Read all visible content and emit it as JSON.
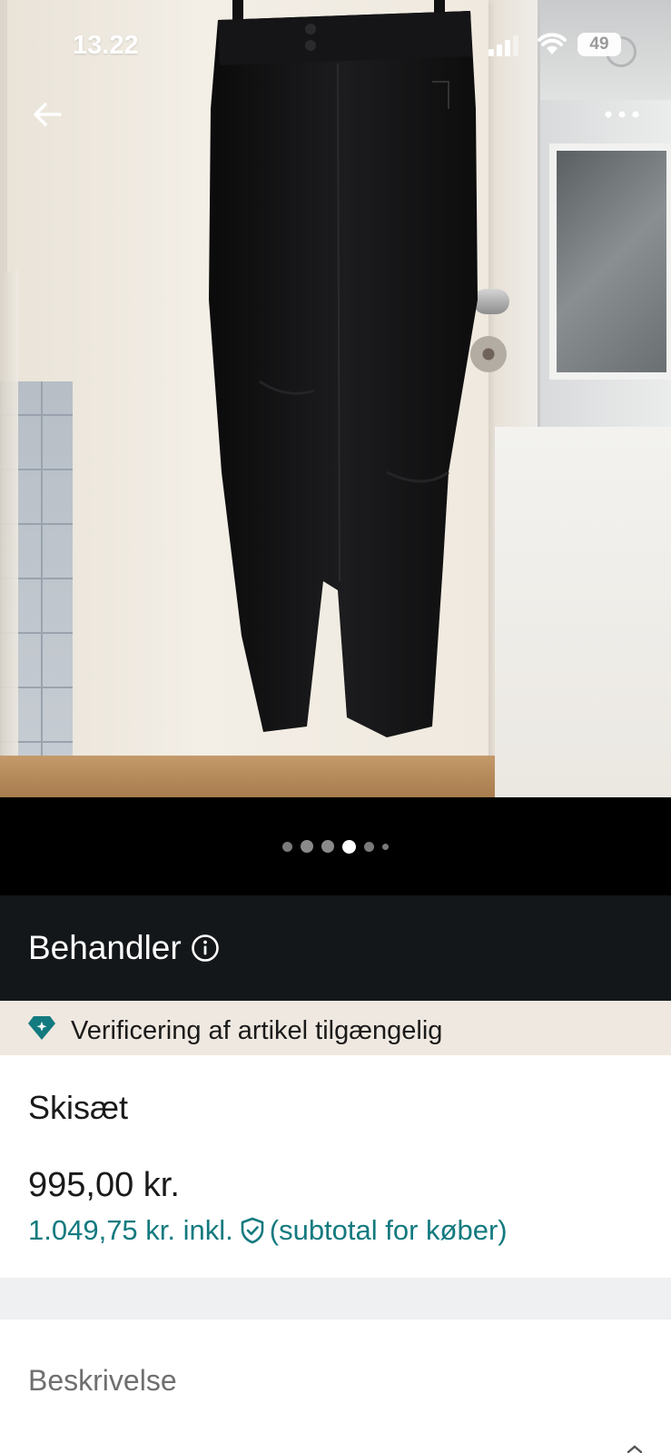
{
  "status_bar": {
    "time": "13.22",
    "battery": "49",
    "signal_icon": "cellular-signal-icon",
    "wifi_icon": "wifi-icon"
  },
  "top_bar": {
    "back_icon": "arrow-left-icon",
    "more_icon": "ellipsis-icon"
  },
  "gallery": {
    "image_subject": "black ski pants hanging on door",
    "dot_count": 6,
    "active_index": 3
  },
  "behandler": {
    "label": "Behandler",
    "icon": "info-icon"
  },
  "verification": {
    "icon": "diamond-icon",
    "text": "Verificering af artikel tilgængelig"
  },
  "item": {
    "title": "Skisæt",
    "price": "995,00 kr.",
    "buyer_price_amount": "1.049,75 kr. inkl.",
    "buyer_price_note": "(subtotal for køber)",
    "shield_icon": "shield-check-icon"
  },
  "description": {
    "title": "Beskrivelse"
  },
  "colors": {
    "accent_teal": "#137a7f",
    "dark_bar": "#141719",
    "banner_bg": "#efe8e0"
  }
}
